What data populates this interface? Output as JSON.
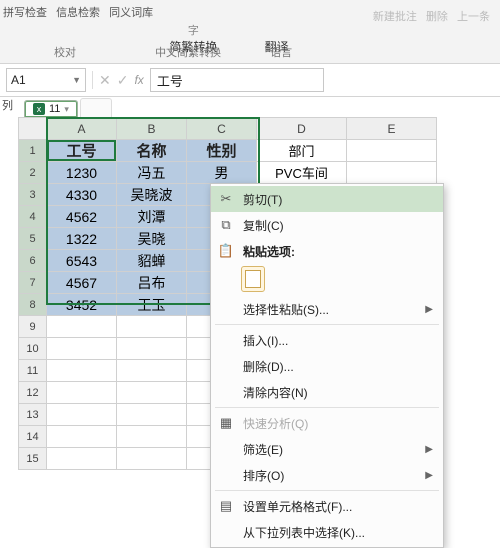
{
  "ribbon": {
    "top": [
      "拼写检查",
      "信息检索",
      "同义词库"
    ],
    "top_right": [
      "新建批注",
      "删除",
      "上一条"
    ],
    "mid": {
      "convert_label": "简繁转换",
      "translate": "翻译"
    },
    "mid2": {
      "trad": "中文简繁转换",
      "lang": "语言"
    },
    "bottom": {
      "proof": "校对"
    }
  },
  "namebox": {
    "ref": "A1",
    "fx": "fx",
    "value": "工号"
  },
  "aside_label": "列",
  "tab": {
    "label": "11"
  },
  "columns": [
    "A",
    "B",
    "C",
    "D",
    "E"
  ],
  "header_row": {
    "c1": "工号",
    "c2": "名称",
    "c3": "性别",
    "c4": "部门"
  },
  "row2": {
    "c1": "1230",
    "c2": "冯五",
    "c3": "男",
    "c4": "PVC车间"
  },
  "row3": {
    "c1": "4330",
    "c2": "吴晓波"
  },
  "row4": {
    "c1": "4562",
    "c2": "刘潭"
  },
  "row5": {
    "c1": "1322",
    "c2": "吴晓"
  },
  "row6": {
    "c1": "6543",
    "c2": "貂蝉"
  },
  "row7": {
    "c1": "4567",
    "c2": "吕布"
  },
  "row8": {
    "c1": "3452",
    "c2": "王玉"
  },
  "rows_blank": [
    "9",
    "10",
    "11",
    "12",
    "13",
    "14",
    "15"
  ],
  "menu": {
    "cut": "剪切(T)",
    "copy": "复制(C)",
    "paste_opts": "粘贴选项:",
    "paste_special": "选择性粘贴(S)...",
    "insert": "插入(I)...",
    "delete": "删除(D)...",
    "clear": "清除内容(N)",
    "quick": "快速分析(Q)",
    "filter": "筛选(E)",
    "sort": "排序(O)",
    "format": "设置单元格格式(F)...",
    "dropdown": "从下拉列表中选择(K)..."
  }
}
